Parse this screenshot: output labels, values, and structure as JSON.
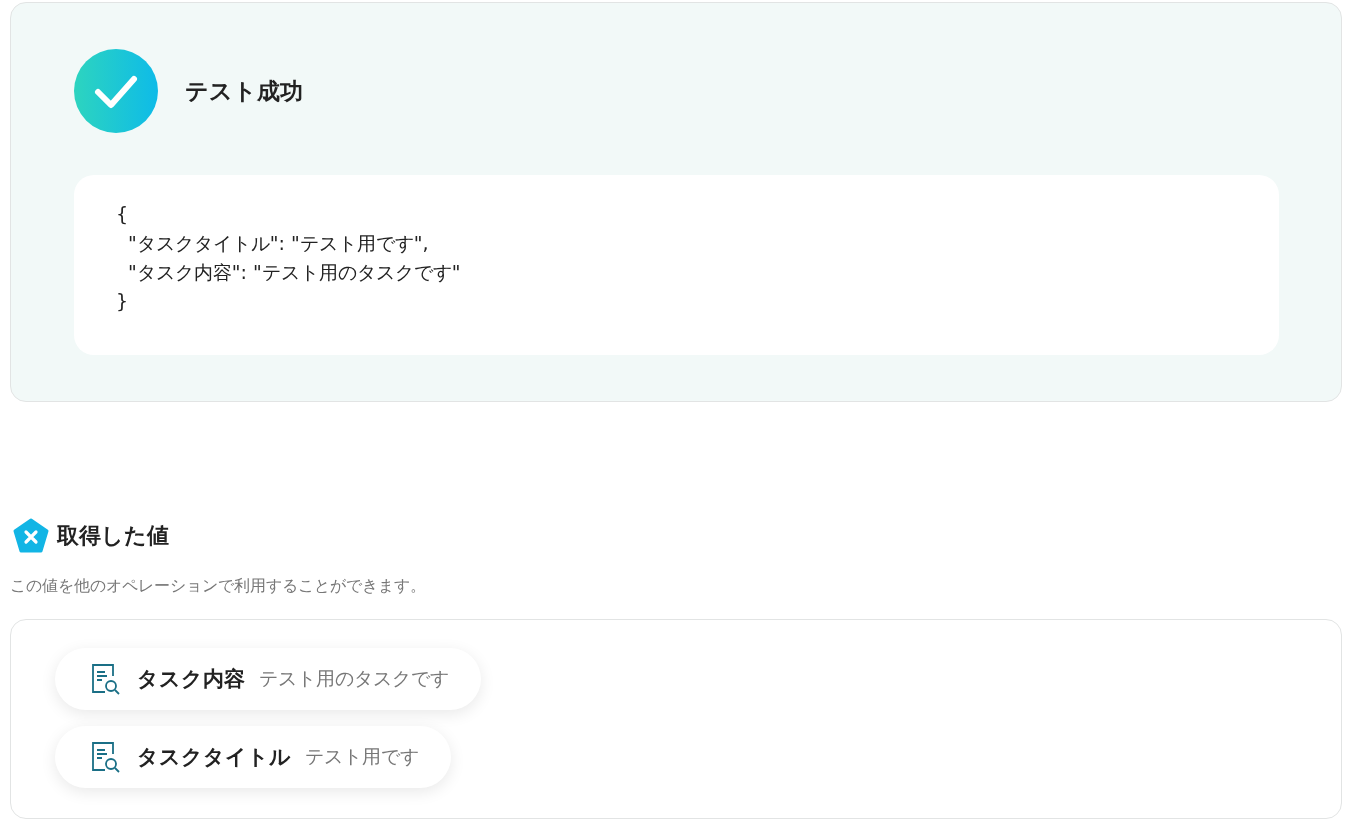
{
  "result": {
    "success": true,
    "title": "テスト成功",
    "output": "{\n  \"タスクタイトル\": \"テスト用です\",\n  \"タスク内容\": \"テスト用のタスクです\"\n}"
  },
  "values_section": {
    "title": "取得した値",
    "description": "この値を他のオペレーションで利用することができます。",
    "items": [
      {
        "name": "タスク内容",
        "value": "テスト用のタスクです"
      },
      {
        "name": "タスクタイトル",
        "value": "テスト用です"
      }
    ]
  }
}
